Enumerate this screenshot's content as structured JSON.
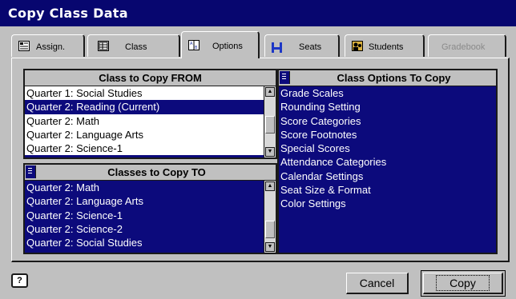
{
  "window": {
    "title": "Copy Class Data"
  },
  "tabs": [
    {
      "label": "Assign.",
      "icon": "assignment-icon",
      "active": false,
      "disabled": false
    },
    {
      "label": "Class",
      "icon": "class-icon",
      "active": false,
      "disabled": false
    },
    {
      "label": "Options",
      "icon": "options-icon",
      "active": true,
      "disabled": false
    },
    {
      "label": "Seats",
      "icon": "seats-icon",
      "active": false,
      "disabled": false
    },
    {
      "label": "Students",
      "icon": "students-icon",
      "active": false,
      "disabled": false
    },
    {
      "label": "Gradebook",
      "icon": "",
      "active": false,
      "disabled": true
    }
  ],
  "from_list": {
    "title": "Class to Copy FROM",
    "items": [
      {
        "label": "Quarter 1: Social Studies",
        "selected": false
      },
      {
        "label": "Quarter 2: Reading (Current)",
        "selected": true
      },
      {
        "label": "Quarter 2: Math",
        "selected": false
      },
      {
        "label": "Quarter 2: Language Arts",
        "selected": false
      },
      {
        "label": "Quarter 2: Science-1",
        "selected": false
      }
    ]
  },
  "to_list": {
    "title": "Classes to Copy TO",
    "items": [
      {
        "label": "Quarter 2: Math",
        "selected": true
      },
      {
        "label": "Quarter 2: Language Arts",
        "selected": true
      },
      {
        "label": "Quarter 2: Science-1",
        "selected": true
      },
      {
        "label": "Quarter 2: Science-2",
        "selected": true
      },
      {
        "label": "Quarter 2: Social Studies",
        "selected": true
      }
    ]
  },
  "options_list": {
    "title": "Class Options To Copy",
    "items": [
      {
        "label": "Grade Scales",
        "selected": true
      },
      {
        "label": "Rounding Setting",
        "selected": true
      },
      {
        "label": "Score Categories",
        "selected": true
      },
      {
        "label": "Score Footnotes",
        "selected": true
      },
      {
        "label": "Special Scores",
        "selected": true
      },
      {
        "label": "Attendance Categories",
        "selected": true
      },
      {
        "label": "Calendar Settings",
        "selected": true
      },
      {
        "label": "Seat Size & Format",
        "selected": true
      },
      {
        "label": "Color Settings",
        "selected": true
      }
    ]
  },
  "footer": {
    "help_label": "?",
    "cancel_label": "Cancel",
    "copy_label": "Copy"
  },
  "colors": {
    "title_bar": "#07066f",
    "selection": "#0c0a7c",
    "face": "#c0c0c0"
  }
}
